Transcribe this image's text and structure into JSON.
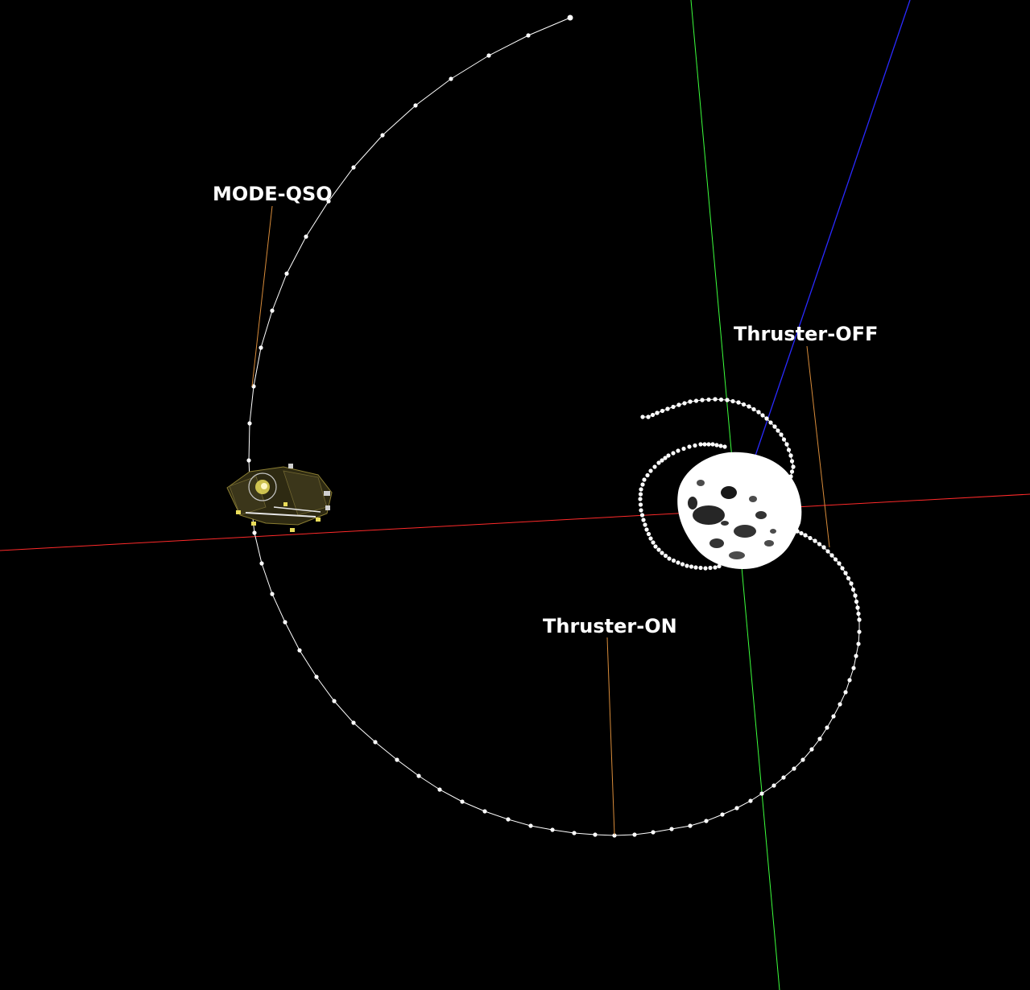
{
  "labels": {
    "mode_qso": "MODE-QSO",
    "thruster_off": "Thruster-OFF",
    "thruster_on": "Thruster-ON"
  },
  "colors": {
    "background": "#000000",
    "x_axis": "#ff2a2a",
    "y_axis": "#3cff3c",
    "z_axis": "#2a2aff",
    "label_leader": "#d98c3a",
    "trajectory": "#ffffff",
    "asteroid": "#ffffff",
    "spacecraft": "#d8c84a"
  },
  "objects": {
    "spacecraft": "spacecraft-model",
    "asteroid": "asteroid-body",
    "trajectory": "spiral-trajectory"
  }
}
